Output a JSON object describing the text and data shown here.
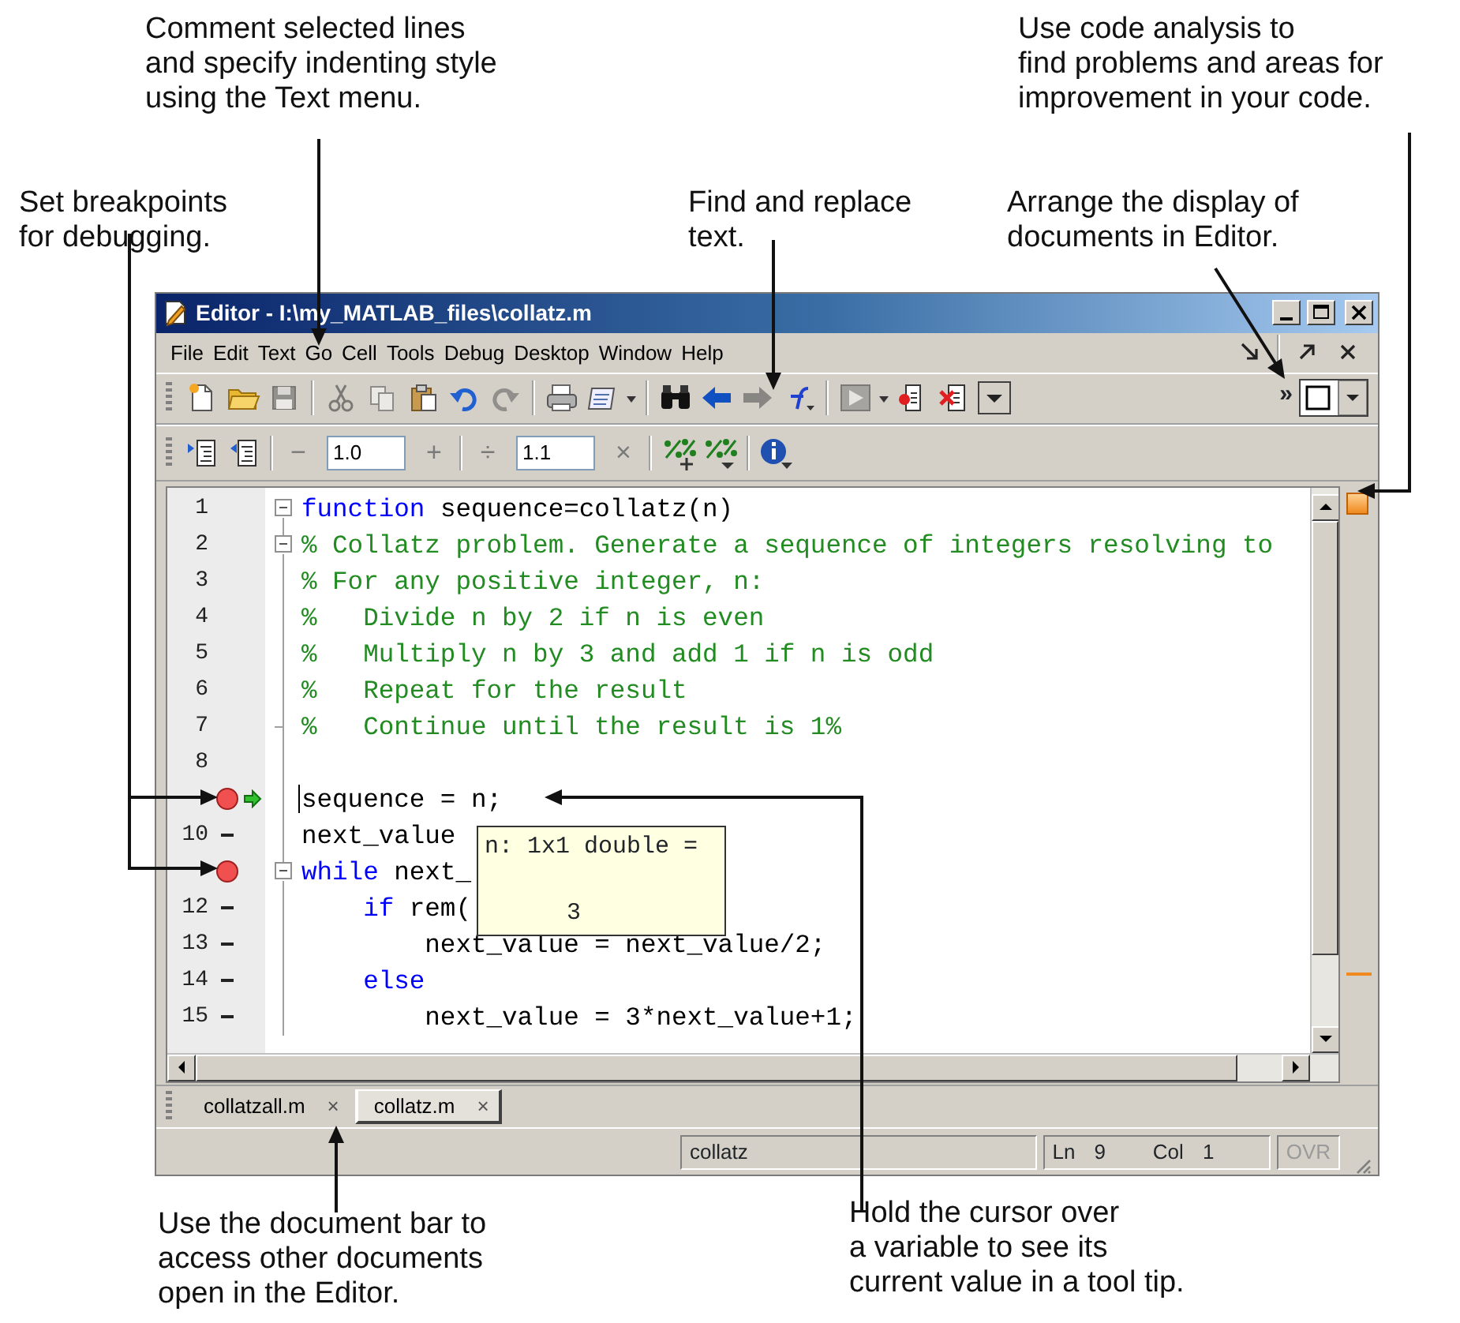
{
  "top_callouts": [
    {
      "text": "Comment selected lines\nand specify indenting style\nusing the Text menu."
    },
    {
      "text": "Use code analysis to\nfind problems and areas for\nimprovement in your code."
    },
    {
      "text": "Set breakpoints\nfor debugging."
    },
    {
      "text": "Find and replace\ntext."
    },
    {
      "text": "Arrange the display of\ndocuments in Editor."
    }
  ],
  "window": {
    "title": "Editor - I:\\my_MATLAB_files\\collatz.m"
  },
  "menu": [
    "File",
    "Edit",
    "Text",
    "Go",
    "Cell",
    "Tools",
    "Debug",
    "Desktop",
    "Window",
    "Help"
  ],
  "toolbar1": {
    "groups": [
      [
        {
          "kind": "new-file",
          "disabled": false
        },
        {
          "kind": "open",
          "disabled": false
        },
        {
          "kind": "save",
          "disabled": true
        }
      ],
      [
        {
          "kind": "cut",
          "disabled": true
        },
        {
          "kind": "copy",
          "disabled": true
        },
        {
          "kind": "paste",
          "disabled": false
        },
        {
          "kind": "undo",
          "disabled": false
        },
        {
          "kind": "redo",
          "disabled": true
        }
      ],
      [
        {
          "kind": "print",
          "disabled": false
        },
        {
          "kind": "publish",
          "disabled": false
        },
        {
          "kind": "caret",
          "disabled": false
        }
      ],
      [
        {
          "kind": "find",
          "disabled": false
        },
        {
          "kind": "back",
          "disabled": false
        },
        {
          "kind": "forward",
          "disabled": true
        },
        {
          "kind": "function",
          "disabled": false
        }
      ],
      [
        {
          "kind": "run",
          "disabled": true
        },
        {
          "kind": "caret",
          "disabled": false
        },
        {
          "kind": "breakpoint-set",
          "disabled": false
        },
        {
          "kind": "breakpoint-clear",
          "disabled": false
        },
        {
          "kind": "dropdown",
          "disabled": false
        }
      ]
    ],
    "overflow": "»"
  },
  "toolbar2": {
    "groups": [
      [
        {
          "kind": "indent-in"
        },
        {
          "kind": "indent-out"
        }
      ],
      [
        {
          "kind": "button",
          "text": "−"
        },
        {
          "kind": "field",
          "value": "1.0"
        },
        {
          "kind": "button",
          "text": "+"
        }
      ],
      [
        {
          "kind": "button",
          "text": "÷"
        },
        {
          "kind": "field",
          "value": "1.1"
        },
        {
          "kind": "button",
          "text": "×"
        }
      ],
      [
        {
          "kind": "cell-insert"
        },
        {
          "kind": "cell-menu"
        }
      ],
      [
        {
          "kind": "info"
        }
      ]
    ]
  },
  "editor": {
    "lines": [
      {
        "number": "1",
        "breakpoint": false,
        "executable": false,
        "current": false,
        "cursor": false,
        "fold_toggle": true,
        "fold_end": false,
        "segments": [
          {
            "kind": "keyword",
            "text": "function"
          },
          {
            "kind": "plain",
            "text": " sequence=collatz(n)"
          }
        ]
      },
      {
        "number": "2",
        "breakpoint": false,
        "executable": false,
        "current": false,
        "cursor": false,
        "fold_toggle": true,
        "fold_end": false,
        "segments": [
          {
            "kind": "comment",
            "text": "% Collatz problem. Generate a sequence of integers resolving to"
          }
        ]
      },
      {
        "number": "3",
        "breakpoint": false,
        "executable": false,
        "current": false,
        "cursor": false,
        "fold_toggle": false,
        "fold_end": false,
        "segments": [
          {
            "kind": "comment",
            "text": "% For any positive integer, n:"
          }
        ]
      },
      {
        "number": "4",
        "breakpoint": false,
        "executable": false,
        "current": false,
        "cursor": false,
        "fold_toggle": false,
        "fold_end": false,
        "segments": [
          {
            "kind": "comment",
            "text": "%   Divide n by 2 if n is even"
          }
        ]
      },
      {
        "number": "5",
        "breakpoint": false,
        "executable": false,
        "current": false,
        "cursor": false,
        "fold_toggle": false,
        "fold_end": false,
        "segments": [
          {
            "kind": "comment",
            "text": "%   Multiply n by 3 and add 1 if n is odd"
          }
        ]
      },
      {
        "number": "6",
        "breakpoint": false,
        "executable": false,
        "current": false,
        "cursor": false,
        "fold_toggle": false,
        "fold_end": false,
        "segments": [
          {
            "kind": "comment",
            "text": "%   Repeat for the result"
          }
        ]
      },
      {
        "number": "7",
        "breakpoint": false,
        "executable": false,
        "current": false,
        "cursor": false,
        "fold_toggle": false,
        "fold_end": true,
        "segments": [
          {
            "kind": "comment",
            "text": "%   Continue until the result is 1%"
          }
        ]
      },
      {
        "number": "8",
        "breakpoint": false,
        "executable": false,
        "current": false,
        "cursor": false,
        "fold_toggle": false,
        "fold_end": false
      },
      {
        "breakpoint": true,
        "executable": true,
        "current": true,
        "cursor": true,
        "fold_toggle": false,
        "fold_end": false,
        "segments": [
          {
            "kind": "plain",
            "text": "sequence = n;"
          }
        ]
      },
      {
        "number": "10",
        "breakpoint": false,
        "executable": true,
        "current": false,
        "cursor": false,
        "fold_toggle": false,
        "fold_end": false,
        "segments": [
          {
            "kind": "plain",
            "text": "next_value"
          }
        ]
      },
      {
        "breakpoint": true,
        "executable": true,
        "current": false,
        "cursor": false,
        "fold_toggle": true,
        "fold_end": false,
        "segments": [
          {
            "kind": "keyword",
            "text": "while"
          },
          {
            "kind": "plain",
            "text": " next_"
          }
        ]
      },
      {
        "number": "12",
        "breakpoint": false,
        "executable": true,
        "current": false,
        "cursor": false,
        "fold_toggle": false,
        "fold_end": false,
        "segments": [
          {
            "kind": "keyword",
            "text": "    if"
          },
          {
            "kind": "plain",
            "text": " rem("
          }
        ]
      },
      {
        "number": "13",
        "breakpoint": false,
        "executable": true,
        "current": false,
        "cursor": false,
        "fold_toggle": false,
        "fold_end": false,
        "segments": [
          {
            "kind": "plain",
            "text": "        next_value = next_value/2;"
          }
        ]
      },
      {
        "number": "14",
        "breakpoint": false,
        "executable": true,
        "current": false,
        "cursor": false,
        "fold_toggle": false,
        "fold_end": false,
        "segments": [
          {
            "kind": "keyword",
            "text": "    else"
          }
        ]
      },
      {
        "number": "15",
        "breakpoint": false,
        "executable": true,
        "current": false,
        "cursor": false,
        "fold_toggle": false,
        "fold_end": false,
        "segments": [
          {
            "kind": "plain",
            "text": "        next_value = 3*next_value+1;"
          }
        ]
      }
    ],
    "tooltip": {
      "lines": [
        "n: 1x1 double =",
        "3"
      ]
    }
  },
  "tabs": [
    {
      "label": "collatzall.m",
      "close": "×",
      "selected": false
    },
    {
      "label": "collatz.m",
      "close": "×",
      "selected": true
    }
  ],
  "status_bar": {
    "function": "collatz",
    "ln_label": "Ln",
    "ln": "9",
    "col_label": "Col",
    "col": "1",
    "ovr": {
      "text": "OVR",
      "disabled": true
    }
  },
  "bottom_callouts": [
    {
      "text": "Use the document bar to\naccess other documents\nopen in the Editor."
    },
    {
      "text": "Hold the cursor over\na variable to see its\ncurrent value in a tool tip."
    }
  ]
}
